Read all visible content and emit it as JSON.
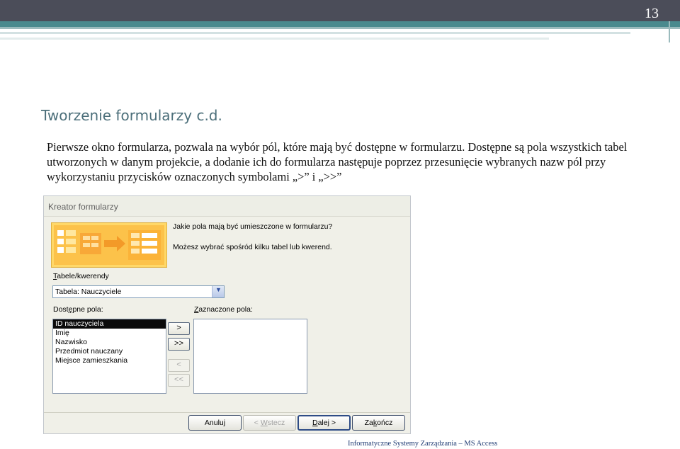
{
  "slide": {
    "number": "13",
    "title": "Tworzenie formularzy c.d.",
    "body": "Pierwsze okno formularza, pozwala na wybór pól, które mają być dostępne w formularzu. Dostępne są pola wszystkich tabel utworzonych w danym projekcie, a dodanie ich do formularza następuje poprzez przesunięcie wybranych nazw pól przy wykorzystaniu przycisków oznaczonych symbolami „>” i „>>”",
    "footer": "Informatyczne Systemy Zarządzania – MS Access"
  },
  "dialog": {
    "title": "Kreator formularzy",
    "prompt_question": "Jakie pola mają być umieszczone w formularzu?",
    "prompt_hint": "Możesz wybrać spośród kilku tabel lub kwerend.",
    "tables_label_underlined": "T",
    "tables_label_rest": "abele/kwerendy",
    "tables_value": "Tabela: Nauczyciele",
    "available_label_pre": "Dost",
    "available_label_underlined": "ę",
    "available_label_post": "pne pola:",
    "selected_label_underlined": "Z",
    "selected_label_rest": "aznaczone pola:",
    "available_fields": [
      "ID nauczyciela",
      "Imię",
      "Nazwisko",
      "Przedmiot nauczany",
      "Miejsce zamieszkania"
    ],
    "selected_fields": [],
    "move_buttons": {
      "add_one": ">",
      "add_all": ">>",
      "remove_one": "<",
      "remove_all": "<<"
    },
    "buttons": {
      "cancel": "Anuluj",
      "back_pre": "< ",
      "back_underlined": "W",
      "back_post": "stecz",
      "next_pre": "",
      "next_underlined": "D",
      "next_post": "alej >",
      "finish_pre": "Za",
      "finish_underlined": "k",
      "finish_post": "ończ"
    }
  }
}
